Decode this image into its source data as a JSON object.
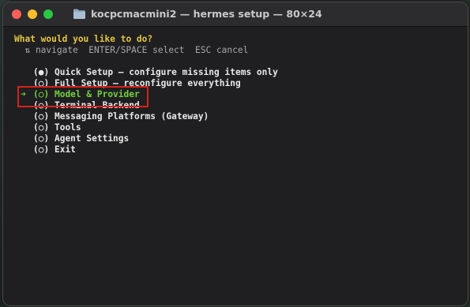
{
  "window": {
    "title": "kocpcmacmini2 — hermes setup — 80×24",
    "colors": {
      "close": "#ff5f57",
      "minimize": "#febc2e",
      "maximize": "#28c840"
    }
  },
  "terminal": {
    "prompt": "What would you like to do?",
    "hint": "  ⇅ navigate  ENTER/SPACE select  ESC cancel",
    "cursor_arrow": "➜",
    "options": [
      {
        "radio": "(●)",
        "label": "Quick Setup – configure missing items only",
        "selected": false
      },
      {
        "radio": "(○)",
        "label": "Full Setup – reconfigure everything",
        "selected": false
      },
      {
        "radio": "(○)",
        "label": "Model & Provider",
        "selected": true
      },
      {
        "radio": "(○)",
        "label": "Terminal Backend",
        "selected": false
      },
      {
        "radio": "(○)",
        "label": "Messaging Platforms (Gateway)",
        "selected": false
      },
      {
        "radio": "(○)",
        "label": "Tools",
        "selected": false
      },
      {
        "radio": "(○)",
        "label": "Agent Settings",
        "selected": false
      },
      {
        "radio": "(○)",
        "label": "Exit",
        "selected": false
      }
    ],
    "colors": {
      "prompt": "#e5c543",
      "selected": "#73d13d",
      "text": "#e8e8e8"
    }
  }
}
